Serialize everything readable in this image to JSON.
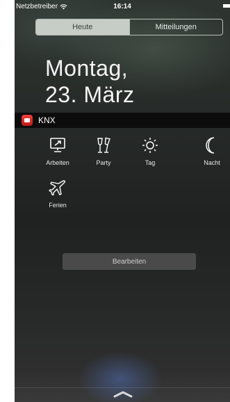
{
  "status_bar": {
    "carrier": "Netzbetreiber",
    "time": "16:14"
  },
  "tabs": [
    {
      "label": "Heute",
      "selected": true
    },
    {
      "label": "Mitteilungen",
      "selected": false
    }
  ],
  "date": {
    "weekday": "Montag,",
    "day_month": "23. März"
  },
  "widget": {
    "app_name": "KNX",
    "scenes": [
      {
        "label": "Arbeiten",
        "icon": "presentation-board-icon"
      },
      {
        "label": "Party",
        "icon": "champagne-glasses-icon"
      },
      {
        "label": "Tag",
        "icon": "sun-icon"
      },
      {
        "label": "Nacht",
        "icon": "moon-icon"
      },
      {
        "label": "Ferien",
        "icon": "airplane-icon"
      }
    ]
  },
  "edit_button_label": "Bearbeiten",
  "colors": {
    "app_icon": "#e02828",
    "tab_selected_bg": "#c6cdc6",
    "button_bg": "#4a4a4a"
  }
}
